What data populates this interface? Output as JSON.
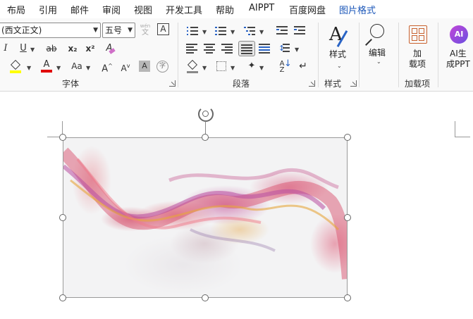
{
  "menu": {
    "tabs": [
      {
        "label": "布局",
        "active": false
      },
      {
        "label": "引用",
        "active": false
      },
      {
        "label": "邮件",
        "active": false
      },
      {
        "label": "审阅",
        "active": false
      },
      {
        "label": "视图",
        "active": false
      },
      {
        "label": "开发工具",
        "active": false
      },
      {
        "label": "帮助",
        "active": false
      },
      {
        "label": "AIPPT",
        "active": false
      },
      {
        "label": "百度网盘",
        "active": false
      },
      {
        "label": "图片格式",
        "active": true
      }
    ]
  },
  "font_group": {
    "label": "字体",
    "font_name": "(西文正文)",
    "font_size": "五号",
    "phonetic_label": "wén",
    "phonetic_char": "文",
    "border_char": "A",
    "italic": "I",
    "underline": "U",
    "strike": "ab",
    "subscript": "x₂",
    "superscript": "x²",
    "clear_format": "A",
    "change_case": "Aa",
    "grow": "A",
    "shrink": "A",
    "shade_char": "A",
    "enclose_char": "字",
    "highlight_color": "#ffff00",
    "font_color": "#e00000"
  },
  "paragraph_group": {
    "label": "段落"
  },
  "styles_group": {
    "label": "样式",
    "button_label": "样式"
  },
  "editing": {
    "button_label": "编辑"
  },
  "addins_group": {
    "label": "加载项",
    "button_label_1": "加",
    "button_label_2": "载项"
  },
  "ai": {
    "button_label_1": "AI生",
    "button_label_2": "成PPT",
    "icon_text": "AI"
  },
  "colors": {
    "accent": "#1a56b8",
    "addin_orange": "#c9622f",
    "ai_purple": "#8a3fd1"
  }
}
